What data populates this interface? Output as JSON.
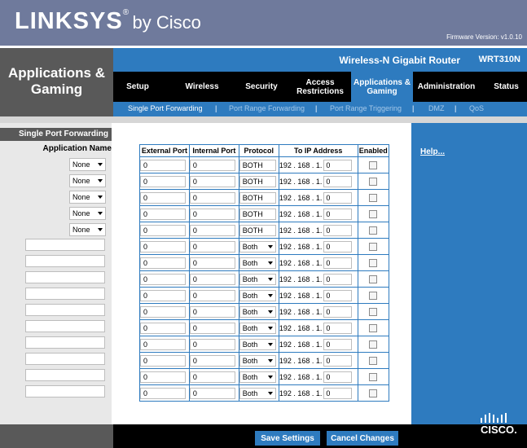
{
  "brand": {
    "main": "LINKSYS",
    "reg": "®",
    "by": "by Cisco",
    "firmware": "Firmware Version: v1.0.10"
  },
  "section_title": "Applications & Gaming",
  "product": {
    "name": "Wireless-N Gigabit Router",
    "model": "WRT310N"
  },
  "tabs": [
    "Setup",
    "Wireless",
    "Security",
    "Access Restrictions",
    "Applications & Gaming",
    "Administration",
    "Status"
  ],
  "subtabs": [
    "Single Port Forwarding",
    "Port Range Forwarding",
    "Port Range Triggering",
    "DMZ",
    "QoS"
  ],
  "left": {
    "title": "Single Port Forwarding",
    "app_name": "Application Name",
    "selects": [
      "None",
      "None",
      "None",
      "None",
      "None"
    ]
  },
  "table": {
    "headers": [
      "External Port",
      "Internal Port",
      "Protocol",
      "To IP Address",
      "Enabled"
    ],
    "rows": [
      {
        "ext": "0",
        "int": "0",
        "proto": "BOTH",
        "ip": "0"
      },
      {
        "ext": "0",
        "int": "0",
        "proto": "BOTH",
        "ip": "0"
      },
      {
        "ext": "0",
        "int": "0",
        "proto": "BOTH",
        "ip": "0"
      },
      {
        "ext": "0",
        "int": "0",
        "proto": "BOTH",
        "ip": "0"
      },
      {
        "ext": "0",
        "int": "0",
        "proto": "BOTH",
        "ip": "0"
      },
      {
        "ext": "0",
        "int": "0",
        "proto": "Both",
        "ip": "0"
      },
      {
        "ext": "0",
        "int": "0",
        "proto": "Both",
        "ip": "0"
      },
      {
        "ext": "0",
        "int": "0",
        "proto": "Both",
        "ip": "0"
      },
      {
        "ext": "0",
        "int": "0",
        "proto": "Both",
        "ip": "0"
      },
      {
        "ext": "0",
        "int": "0",
        "proto": "Both",
        "ip": "0"
      },
      {
        "ext": "0",
        "int": "0",
        "proto": "Both",
        "ip": "0"
      },
      {
        "ext": "0",
        "int": "0",
        "proto": "Both",
        "ip": "0"
      },
      {
        "ext": "0",
        "int": "0",
        "proto": "Both",
        "ip": "0"
      },
      {
        "ext": "0",
        "int": "0",
        "proto": "Both",
        "ip": "0"
      },
      {
        "ext": "0",
        "int": "0",
        "proto": "Both",
        "ip": "0"
      }
    ],
    "ip_prefix": "192 . 168 . 1."
  },
  "help": "Help...",
  "buttons": {
    "save": "Save Settings",
    "cancel": "Cancel Changes"
  },
  "cisco": "CISCO.",
  "colors": {
    "blue": "#2e7bbf",
    "header": "#6f7a9c",
    "dark": "#595959"
  }
}
